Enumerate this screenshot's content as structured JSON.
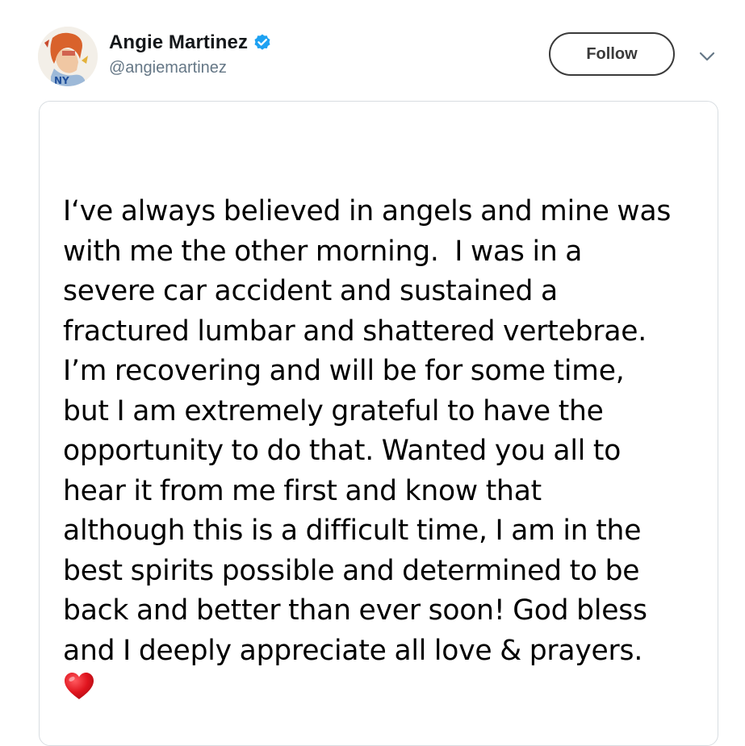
{
  "tweet": {
    "author": {
      "display_name": "Angie Martinez",
      "handle": "@angiemartinez",
      "verified": true,
      "avatar_icon": "avatar-photo",
      "verified_icon": "verified-badge-icon",
      "verified_color": "#1da1f2"
    },
    "follow_label": "Follow",
    "menu_icon": "chevron-down-icon",
    "image": {
      "text_lines": [
        "I‘ve always believed in angels and mine was",
        "with me the other morning.  I was in a",
        "severe car accident and sustained a",
        "fractured lumbar and shattered vertebrae.",
        "I’m recovering and will be for some time,",
        "but I am extremely grateful to have the",
        "opportunity to do that. Wanted you all to",
        "hear it from me first and know that",
        "although this is a difficult time, I am in the",
        "best spirits possible and determined to be",
        "back and better than ever soon! God bless",
        "and I deeply appreciate all love & prayers."
      ],
      "emoji_icon": "red-heart-icon",
      "emoji_color": "#e0141e"
    }
  }
}
